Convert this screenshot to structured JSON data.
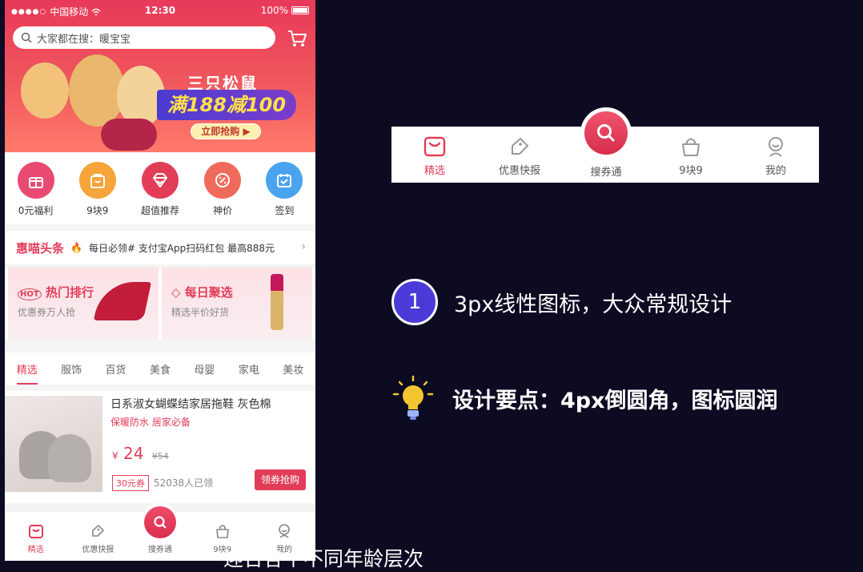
{
  "phone": {
    "status": {
      "carrier": "中国移动",
      "time": "12:30",
      "battery": "100%"
    },
    "search": {
      "placeholder": "大家都在搜：暖宝宝"
    },
    "banner": {
      "brand": "三只松鼠",
      "promo": "满188减100",
      "button": "立即抢购"
    },
    "categories": [
      {
        "label": "0元福利",
        "color": "#e94a71"
      },
      {
        "label": "9块9",
        "color": "#f5a53a"
      },
      {
        "label": "超值推荐",
        "color": "#e23d58"
      },
      {
        "label": "神价",
        "color": "#ef6a5a"
      },
      {
        "label": "签到",
        "color": "#4aa3ef"
      }
    ],
    "headline": {
      "title": "惠喵头条",
      "text": "每日必领# 支付宝App扫码红包 最高888元"
    },
    "promos": [
      {
        "title": "热门排行",
        "sub": "优惠券万人抢"
      },
      {
        "title": "每日聚选",
        "sub": "精选半价好货"
      }
    ],
    "tabs": [
      "精选",
      "服饰",
      "百货",
      "美食",
      "母婴",
      "家电",
      "美妆"
    ],
    "product": {
      "title": "日系淑女蝴蝶结家居拖鞋 灰色棉",
      "tags": "保暖防水 居家必备",
      "price": "24",
      "old_price": "¥54",
      "coupon": "30元券",
      "sold": "52038人已领",
      "button": "领券抢购"
    },
    "nav": [
      "精选",
      "优惠快报",
      "搜券通",
      "9块9",
      "我的"
    ]
  },
  "tabbar_example": {
    "items": [
      "精选",
      "优惠快报",
      "搜券通",
      "9块9",
      "我的"
    ],
    "accent": "#e23d58"
  },
  "points": {
    "number": "1",
    "first": "3px线性图标，大众常规设计",
    "second": "设计要点：4px倒圆角，图标圆润"
  },
  "subtitle": "迎合各个不同年龄层次"
}
